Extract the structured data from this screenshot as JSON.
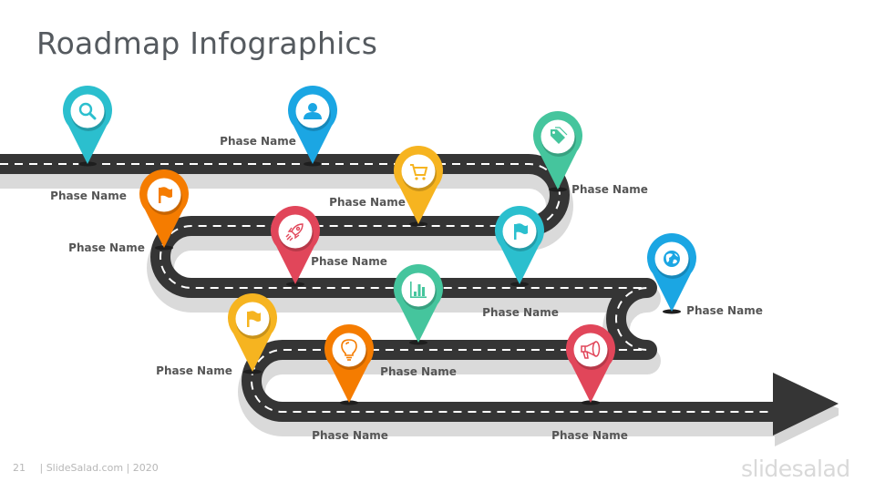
{
  "slide": {
    "title": "Roadmap Infographics",
    "page_number": "21",
    "footer_text": "| SlideSalad.com | 2020",
    "logo_text": "slidesalad"
  },
  "colors": {
    "road": "#353535",
    "road_shadow": "#d9d9d9",
    "lane_marking": "#ffffff",
    "cyan": "#2bbfce",
    "blue": "#1ba6e3",
    "teal_green": "#45c59d",
    "yellow": "#f6b420",
    "orange": "#f57c00",
    "red": "#e1465a"
  },
  "phases": [
    {
      "label": "Phase Name",
      "icon": "search-icon",
      "color": "#2bbfce"
    },
    {
      "label": "Phase Name",
      "icon": "user-icon",
      "color": "#1ba6e3"
    },
    {
      "label": "Phase Name",
      "icon": "tag-icon",
      "color": "#45c59d"
    },
    {
      "label": "Phase Name",
      "icon": "cart-icon",
      "color": "#f6b420"
    },
    {
      "label": "Phase Name",
      "icon": "flag-icon",
      "color": "#f57c00"
    },
    {
      "label": "Phase Name",
      "icon": "rocket-icon",
      "color": "#e1465a"
    },
    {
      "label": "Phase Name",
      "icon": "flag-icon",
      "color": "#2bbfce"
    },
    {
      "label": "Phase Name",
      "icon": "globe-icon",
      "color": "#1ba6e3"
    },
    {
      "label": "Phase Name",
      "icon": "bar-chart-icon",
      "color": "#45c59d"
    },
    {
      "label": "Phase Name",
      "icon": "flag-icon",
      "color": "#f6b420"
    },
    {
      "label": "Phase Name",
      "icon": "lightbulb-icon",
      "color": "#f57c00"
    },
    {
      "label": "Phase Name",
      "icon": "megaphone-icon",
      "color": "#e1465a"
    }
  ]
}
